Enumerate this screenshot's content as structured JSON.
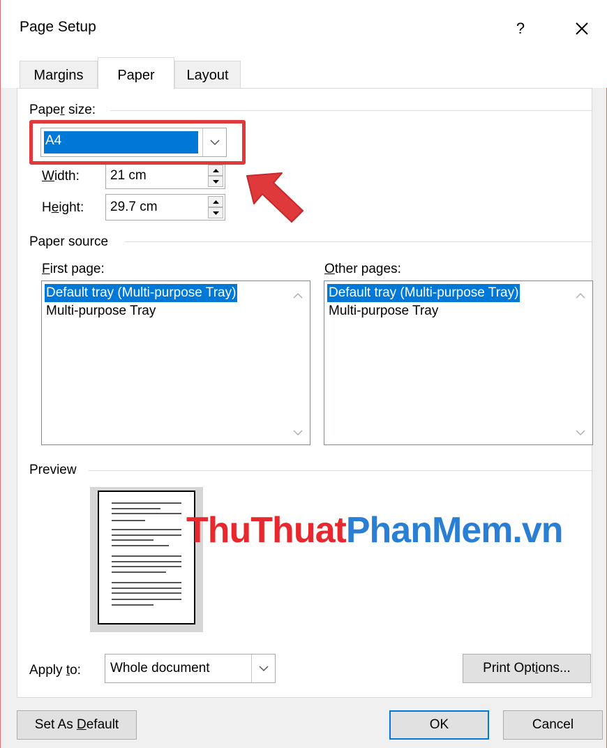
{
  "dialog": {
    "title": "Page Setup",
    "help": "?",
    "close_icon": "close-icon"
  },
  "tabs": [
    {
      "label": "Margins",
      "active": false
    },
    {
      "label": "Paper",
      "active": true
    },
    {
      "label": "Layout",
      "active": false
    }
  ],
  "paper_size": {
    "section_label_pre": "Pape",
    "section_label_u": "r",
    "section_label_post": " size:",
    "value": "A4",
    "width_label_u": "W",
    "width_label_post": "idth:",
    "width_value": "21 cm",
    "height_label_pre": "H",
    "height_label_u": "e",
    "height_label_post": "ight:",
    "height_value": "29.7 cm"
  },
  "paper_source": {
    "section_label": "Paper source",
    "first_page_label_u": "F",
    "first_page_label_post": "irst page:",
    "other_pages_label_u": "O",
    "other_pages_label_post": "ther pages:",
    "first_page_items": [
      "Default tray (Multi-purpose Tray)",
      "Multi-purpose Tray"
    ],
    "other_pages_items": [
      "Default tray (Multi-purpose Tray)",
      "Multi-purpose Tray"
    ]
  },
  "preview": {
    "section_label": "Preview",
    "watermark_red": "ThuThuat",
    "watermark_blue": "PhanMem.vn"
  },
  "apply_to": {
    "label_pre": "Apply ",
    "label_u": "t",
    "label_post": "o:",
    "value": "Whole document"
  },
  "buttons": {
    "print_options_pre": "Print Opt",
    "print_options_u": "i",
    "print_options_post": "ons...",
    "set_default_pre": "Set As ",
    "set_default_u": "D",
    "set_default_post": "efault",
    "ok": "OK",
    "cancel": "Cancel"
  },
  "colors": {
    "selection": "#0078d7",
    "highlight_annotation": "#e0393c"
  }
}
